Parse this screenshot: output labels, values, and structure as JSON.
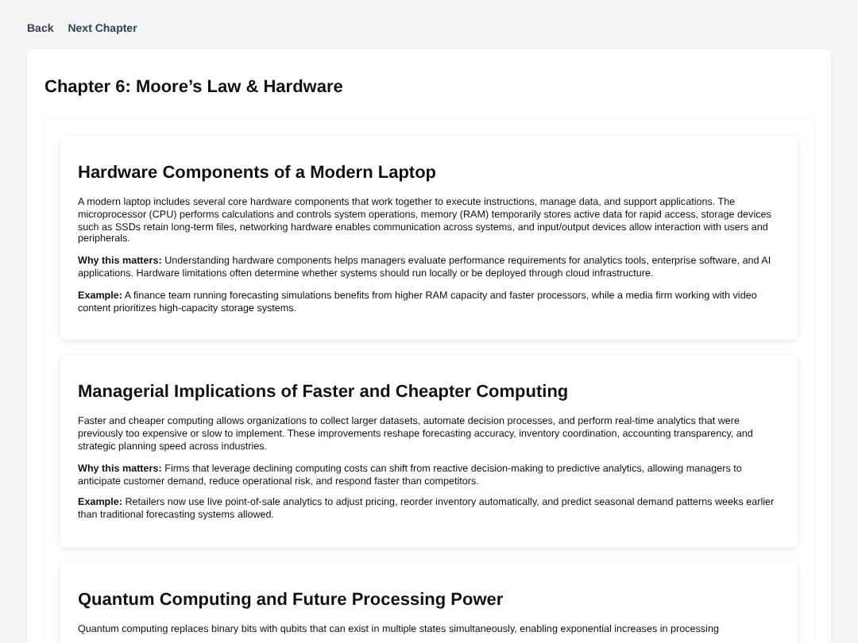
{
  "nav": [
    {
      "label": "Back"
    },
    {
      "label": "Next Chapter"
    }
  ],
  "chapter_title": "Chapter 6: Moore’s Law & Hardware",
  "sections": [
    {
      "title": "Hardware Components of a Modern Laptop",
      "paragraphs": [
        "A modern laptop includes several core hardware components that work together to execute instructions, manage data, and support applications. The microprocessor (CPU) performs calculations and controls system operations, memory (RAM) temporarily stores active data for rapid access, storage devices such as SSDs retain long-term files, networking hardware enables communication across systems, and input/output devices allow interaction with users and peripherals.",
        "**Why this matters:** Understanding hardware components helps managers evaluate performance requirements for analytics tools, enterprise software, and AI applications. Hardware limitations often determine whether systems should run locally or be deployed through cloud infrastructure.",
        "**Example:** A finance team running forecasting simulations benefits from higher RAM capacity and faster processors, while a media firm working with video content prioritizes high-capacity storage systems."
      ]
    },
    {
      "title": "Managerial Implications of Faster and Cheapter Computing",
      "paragraphs": [
        "Faster and cheaper computing allows organizations to collect larger datasets, automate decision processes, and perform real-time analytics that were previously too expensive or slow to implement. These improvements reshape forecasting accuracy, inventory coordination, accounting transparency, and strategic planning speed across industries.",
        "**Why this matters:** Firms that leverage declining computing costs can shift from reactive decision-making to predictive analytics, allowing managers to anticipate customer demand, reduce operational risk, and respond faster than competitors.",
        "**Example:** Retailers now use live point-of-sale analytics to adjust pricing, reorder inventory automatically, and predict seasonal demand patterns weeks earlier than traditional forecasting systems allowed."
      ]
    },
    {
      "title": "Quantum Computing and Future Processing Power",
      "paragraphs": [
        "Quantum computing replaces binary bits with qubits that can exist in multiple states simultaneously, enabling exponential increases in processing"
      ]
    }
  ]
}
